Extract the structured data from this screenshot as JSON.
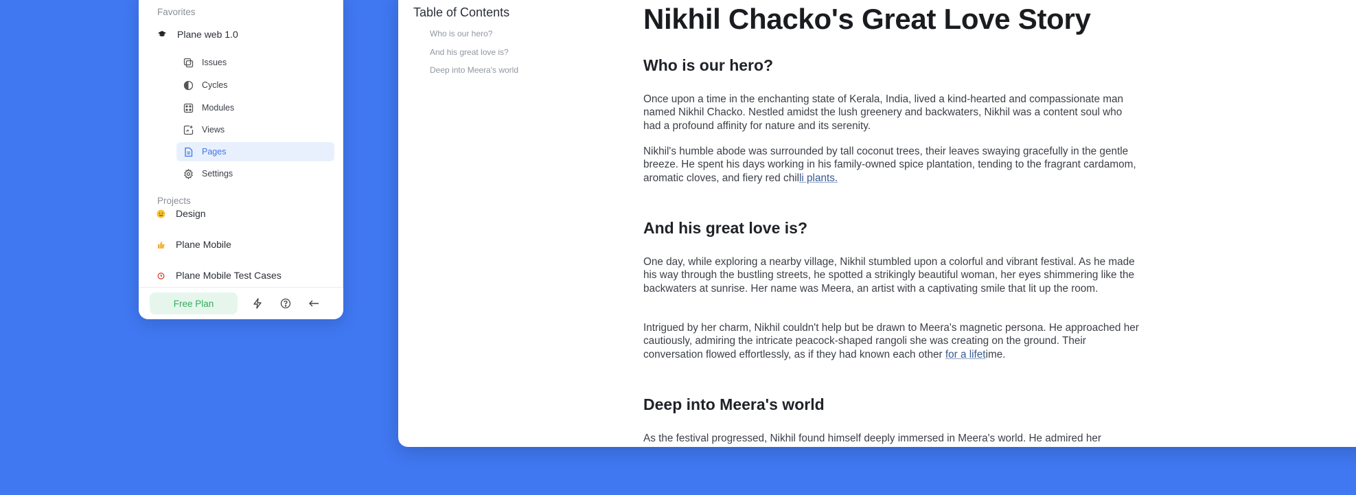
{
  "sidebar": {
    "favorites_label": "Favorites",
    "favorite_project": "Plane web 1.0",
    "sub_items": [
      {
        "label": "Issues",
        "icon": "issues-icon"
      },
      {
        "label": "Cycles",
        "icon": "cycles-icon"
      },
      {
        "label": "Modules",
        "icon": "modules-icon"
      },
      {
        "label": "Views",
        "icon": "views-icon"
      },
      {
        "label": "Pages",
        "icon": "pages-icon",
        "active": true
      },
      {
        "label": "Settings",
        "icon": "settings-icon"
      }
    ],
    "projects_label": "Projects",
    "projects": [
      {
        "label": "Design",
        "icon": "emoji-face-icon"
      },
      {
        "label": "Plane Mobile",
        "icon": "emoji-thumbs-up-icon"
      },
      {
        "label": "Plane Mobile Test Cases",
        "icon": "emoji-alarm-clock-icon"
      }
    ],
    "footer": {
      "free_plan_label": "Free Plan",
      "icons": [
        "lightning-icon",
        "help-icon",
        "collapse-arrow-icon"
      ]
    }
  },
  "toc": {
    "title": "Table of Contents",
    "items": [
      "Who is our hero?",
      "And his great love is?",
      "Deep into Meera's world"
    ]
  },
  "document": {
    "title": "Nikhil Chacko's Great Love Story",
    "sections": [
      {
        "heading": "Who is our hero?",
        "paragraphs": [
          "Once upon a time in the enchanting state of Kerala, India, lived a kind-hearted and compassionate man named Nikhil Chacko. Nestled amidst the lush greenery and backwaters, Nikhil was a content soul who had a profound affinity for nature and its serenity.",
          {
            "before": "Nikhil's humble abode was surrounded by tall coconut trees, their leaves swaying gracefully in the gentle breeze. He spent his days working in his family-owned spice plantation, tending to the fragrant cardamom, aromatic cloves, and fiery red chil",
            "link": "li plants.",
            "after": ""
          }
        ]
      },
      {
        "heading": "And his great love is?",
        "paragraphs": [
          "One day, while exploring a nearby village, Nikhil stumbled upon a colorful and vibrant festival. As he made his way through the bustling streets, he spotted a strikingly beautiful woman, her eyes shimmering like the backwaters at sunrise. Her name was Meera, an artist with a captivating smile that lit up the room.",
          {
            "before": "Intrigued by her charm, Nikhil couldn't help but be drawn to Meera's magnetic persona. He approached her cautiously, admiring the intricate peacock-shaped rangoli she was creating on the ground. Their conversation flowed effortlessly, as if they had known each other ",
            "link": "for a lifet",
            "after": "ime."
          }
        ]
      },
      {
        "heading": "Deep into Meera's world",
        "paragraphs": [
          "As the festival progressed, Nikhil found himself deeply immersed in Meera's world. He admired her"
        ]
      }
    ]
  },
  "colors": {
    "background": "#4078f2",
    "accent": "#3f76e6",
    "free_plan_text": "#2fae5c",
    "free_plan_bg": "#e6f6ec"
  }
}
